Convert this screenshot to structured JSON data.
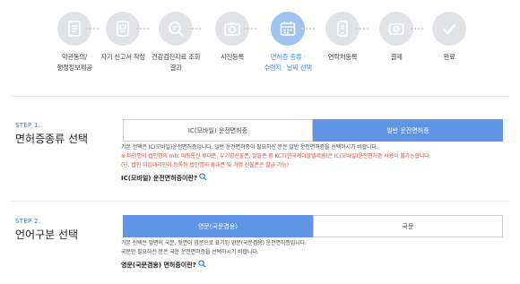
{
  "steps": [
    {
      "label_line1": "약관동의/",
      "label_line2": "행정정보제공",
      "icon": "document-icon"
    },
    {
      "label_line1": "자기 신고서 작성",
      "label_line2": "",
      "icon": "form-icon"
    },
    {
      "label_line1": "건강검진자료 조회",
      "label_line2": "결과",
      "icon": "search-doc-icon"
    },
    {
      "label_line1": "사진등록",
      "label_line2": "",
      "icon": "camera-icon"
    },
    {
      "label_line1": "면허증 종류 ·",
      "label_line2": "수령지 · 날짜 선택",
      "icon": "calendar-icon",
      "active": true
    },
    {
      "label_line1": "연락처등록",
      "label_line2": "",
      "icon": "phone-icon"
    },
    {
      "label_line1": "결제",
      "label_line2": "",
      "icon": "wallet-icon"
    },
    {
      "label_line1": "완료",
      "label_line2": "",
      "icon": "check-icon"
    }
  ],
  "section1": {
    "step_no": "STEP 1.",
    "title": "면허증종류 선택",
    "option_ic": "IC(모바일) 운전면허증",
    "option_general": "일반 운전면허증",
    "desc1": "기본 선택은 IC(모바일)운전면허증입니다. 일반 운전면허증이 필요하신 분은 일반 운전면허증을 선택하시기 바랍니다.",
    "desc2": "※ 타인명의·법인명의·mtc 이동통신 휴대폰, 우기명선불폰, 알뜰폰 중 KCT(한국케이블텔레콤)은 IC(모바일)운전면허증 사용이 불가능합니다.",
    "desc3": "(단, 법인 위임대리인이 등록된 법인명의 휴대폰 및 기명 선불폰은 발급 가능)",
    "link": "IC(모바일) 운전면허증이란?"
  },
  "section2": {
    "step_no": "STEP 2.",
    "title": "언어구분 선택",
    "option_english": "영문(국문겸용)",
    "option_korean": "국문",
    "desc1": "기본 선택은 앞면이 국문, 뒷면이 영문으로 표기된 영문(국문겸용) 운전면허증입니다.",
    "desc2": "국문만 필요하신 분은 국문 운전면허증을 선택하시기 바랍니다.",
    "link": "영문(국문겸용) 면허증이란?"
  },
  "colors": {
    "accent": "#5f95e6",
    "active_step": "#9ec3ef",
    "inactive_step": "#e1e3e6",
    "warning": "#d94a3a"
  }
}
